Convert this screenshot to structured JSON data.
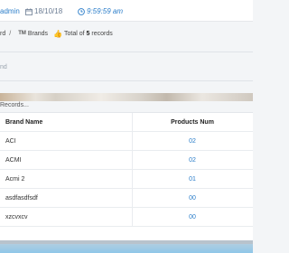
{
  "topbar": {
    "user_name": "admin",
    "date": "18/10/18",
    "time": "9:59:59 am"
  },
  "breadcrumb": {
    "parent": "rd",
    "current": "Brands",
    "total_prefix": "Total of",
    "total_count": "5",
    "total_suffix": "records"
  },
  "filter": {
    "label": "nd"
  },
  "records_label": "Records...",
  "table": {
    "headers": [
      "Brand Name",
      "Products Num"
    ],
    "rows": [
      {
        "name": "ACI",
        "count": "02"
      },
      {
        "name": "ACMI",
        "count": "02"
      },
      {
        "name": "Acmi 2",
        "count": "01"
      },
      {
        "name": "asdfasdfsdf",
        "count": "00"
      },
      {
        "name": "xzcvxcv",
        "count": "00"
      }
    ]
  },
  "colors": {
    "accent": "#2a7dc9",
    "success": "#5cb85c"
  }
}
